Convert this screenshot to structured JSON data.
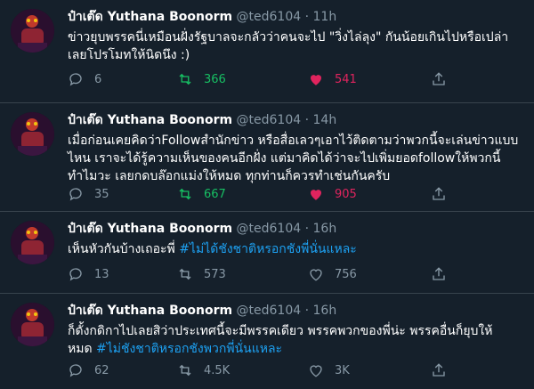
{
  "tweets": [
    {
      "name": "ป๋าเต๊ด Yuthana Boonorm",
      "handle": "@ted6104",
      "dot": "·",
      "time": "11h",
      "text": "ข่าวยุบพรรคนี่เหมือนฝั่งรัฐบาลจะกลัวว่าคนจะไป \"วิ่งไล่ลุง\" กันน้อยเกินไปหรือเปล่า\nเลยโปรโมทให้นิดนึง :)",
      "hashtag": "",
      "replies": "6",
      "retweets": "366",
      "likes": "541",
      "retweeted": true,
      "liked": true
    },
    {
      "name": "ป๋าเต๊ด Yuthana Boonorm",
      "handle": "@ted6104",
      "dot": "·",
      "time": "14h",
      "text": "เมื่อก่อนเคยคิดว่าFollowสำนักข่าว หรือสื่อเลวๆเอาไว้ติดตามว่าพวกนี้จะเล่นข่าวแบบ\nไหน เราจะได้รู้ความเห็นของคนอีกฝั่ง แต่มาคิดได้ว่าจะไปเพิ่มยอดfollowให้พวกนี้\nทำไมวะ เลยกดบล๊อกแม่งให้หมด ทุกท่านก็ควรทำเช่นกันครับ",
      "hashtag": "",
      "replies": "35",
      "retweets": "667",
      "likes": "905",
      "retweeted": true,
      "liked": true
    },
    {
      "name": "ป๋าเต๊ด Yuthana Boonorm",
      "handle": "@ted6104",
      "dot": "·",
      "time": "16h",
      "text": "เห็นหัวกันบ้างเถอะพี่ ",
      "hashtag": "#ไม่ได้ชังชาติหรอกชังพี่นั่นแหละ",
      "replies": "13",
      "retweets": "573",
      "likes": "756",
      "retweeted": false,
      "liked": false
    },
    {
      "name": "ป๋าเต๊ด Yuthana Boonorm",
      "handle": "@ted6104",
      "dot": "·",
      "time": "16h",
      "text": "ก็ดั้งกดิกาไปเลยสิว่าประเทศนี้จะมีพรรคเดียว พรรคพวกของพี่น่ะ พรรคอื่นก็ยุบให้\nหมด ",
      "hashtag": "#ไม่ชังชาติหรอกชังพวกพี่นั่นแหละ",
      "replies": "62",
      "retweets": "4.5K",
      "likes": "3K",
      "retweeted": false,
      "liked": false
    }
  ],
  "colors": {
    "background": "#15202b",
    "divider": "#38444d",
    "muted": "#8899a6",
    "link": "#1da1f2",
    "retweet_active": "#17bf63",
    "like_active": "#e0245e"
  },
  "icons": [
    "avatar",
    "reply-icon",
    "retweet-icon",
    "like-icon",
    "share-icon"
  ]
}
